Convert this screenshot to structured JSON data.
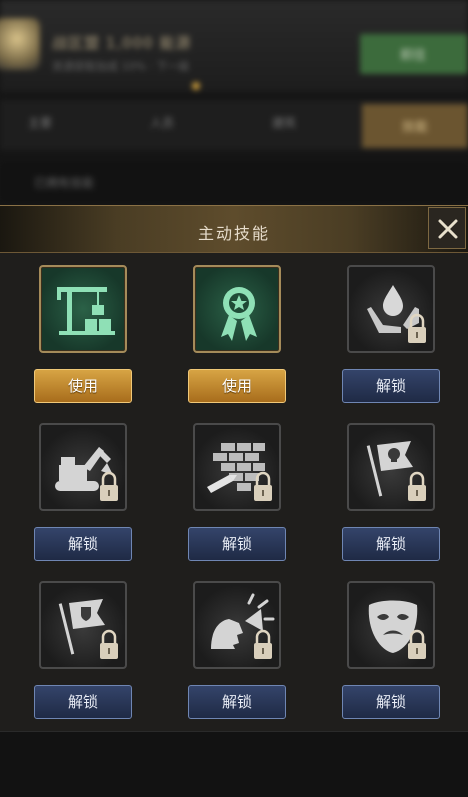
{
  "background": {
    "headline": "战区盟 1,000 能源",
    "subline": "资源获取加成 10% · 下一级",
    "green_button": "前往",
    "tabs": [
      "主要",
      "人员",
      "建筑",
      "技能"
    ],
    "row_label": "已拥有技能"
  },
  "modal": {
    "title": "主动技能",
    "close_icon": "close-icon"
  },
  "skills": [
    {
      "icon": "construction-crane-icon",
      "state": "active",
      "button": "使用"
    },
    {
      "icon": "medal-ribbon-icon",
      "state": "active",
      "button": "使用"
    },
    {
      "icon": "hands-water-drop-icon",
      "state": "locked",
      "button": "解锁"
    },
    {
      "icon": "excavator-icon",
      "state": "locked",
      "button": "解锁"
    },
    {
      "icon": "brick-wall-bullet-icon",
      "state": "locked",
      "button": "解锁"
    },
    {
      "icon": "skull-flag-icon",
      "state": "locked",
      "button": "解锁"
    },
    {
      "icon": "shield-flag-icon",
      "state": "locked",
      "button": "解锁"
    },
    {
      "icon": "shouting-head-icon",
      "state": "locked",
      "button": "解锁"
    },
    {
      "icon": "theater-mask-icon",
      "state": "locked",
      "button": "解锁"
    }
  ],
  "colors": {
    "use_button": "#c28a30",
    "unlock_button": "#2a3858",
    "active_icon_bg": "#1f4a36",
    "header_gold": "#5e4c2c"
  }
}
